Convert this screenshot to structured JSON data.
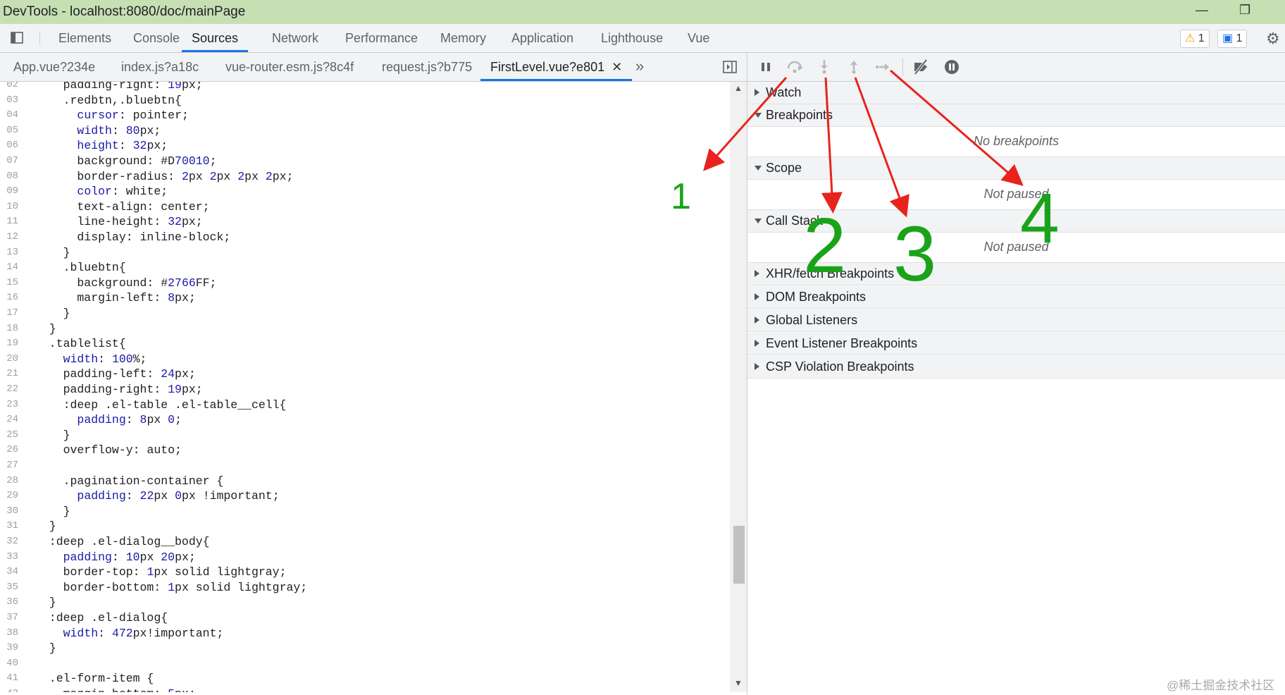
{
  "window": {
    "title": "DevTools - localhost:8080/doc/mainPage"
  },
  "panels": [
    {
      "label": "Elements"
    },
    {
      "label": "Console"
    },
    {
      "label": "Sources"
    },
    {
      "label": "Network"
    },
    {
      "label": "Performance"
    },
    {
      "label": "Memory"
    },
    {
      "label": "Application"
    },
    {
      "label": "Lighthouse"
    },
    {
      "label": "Vue"
    }
  ],
  "badges": {
    "warnings": "1",
    "messages": "1"
  },
  "file_tabs": [
    {
      "label": "App.vue?234e"
    },
    {
      "label": "index.js?a18c"
    },
    {
      "label": "vue-router.esm.js?8c4f"
    },
    {
      "label": "request.js?b775"
    },
    {
      "label": "FirstLevel.vue?e801"
    }
  ],
  "code_lines": [
    {
      "n": "02",
      "t": "    padding-right: 19px;"
    },
    {
      "n": "03",
      "t": "    .redbtn,.bluebtn{"
    },
    {
      "n": "04",
      "t": "      cursor: pointer;"
    },
    {
      "n": "05",
      "t": "      width: 80px;"
    },
    {
      "n": "06",
      "t": "      height: 32px;"
    },
    {
      "n": "07",
      "t": "      background: #D70010;"
    },
    {
      "n": "08",
      "t": "      border-radius: 2px 2px 2px 2px;"
    },
    {
      "n": "09",
      "t": "      color: white;"
    },
    {
      "n": "10",
      "t": "      text-align: center;"
    },
    {
      "n": "11",
      "t": "      line-height: 32px;"
    },
    {
      "n": "12",
      "t": "      display: inline-block;"
    },
    {
      "n": "13",
      "t": "    }"
    },
    {
      "n": "14",
      "t": "    .bluebtn{"
    },
    {
      "n": "15",
      "t": "      background: #2766FF;"
    },
    {
      "n": "16",
      "t": "      margin-left: 8px;"
    },
    {
      "n": "17",
      "t": "    }"
    },
    {
      "n": "18",
      "t": "  }"
    },
    {
      "n": "19",
      "t": "  .tablelist{"
    },
    {
      "n": "20",
      "t": "    width: 100%;"
    },
    {
      "n": "21",
      "t": "    padding-left: 24px;"
    },
    {
      "n": "22",
      "t": "    padding-right: 19px;"
    },
    {
      "n": "23",
      "t": "    :deep .el-table .el-table__cell{"
    },
    {
      "n": "24",
      "t": "      padding: 8px 0;"
    },
    {
      "n": "25",
      "t": "    }"
    },
    {
      "n": "26",
      "t": "    overflow-y: auto;"
    },
    {
      "n": "27",
      "t": ""
    },
    {
      "n": "28",
      "t": "    .pagination-container {"
    },
    {
      "n": "29",
      "t": "      padding: 22px 0px !important;"
    },
    {
      "n": "30",
      "t": "    }"
    },
    {
      "n": "31",
      "t": "  }"
    },
    {
      "n": "32",
      "t": "  :deep .el-dialog__body{"
    },
    {
      "n": "33",
      "t": "    padding: 10px 20px;"
    },
    {
      "n": "34",
      "t": "    border-top: 1px solid lightgray;"
    },
    {
      "n": "35",
      "t": "    border-bottom: 1px solid lightgray;"
    },
    {
      "n": "36",
      "t": "  }"
    },
    {
      "n": "37",
      "t": "  :deep .el-dialog{"
    },
    {
      "n": "38",
      "t": "    width: 472px!important;"
    },
    {
      "n": "39",
      "t": "  }"
    },
    {
      "n": "40",
      "t": ""
    },
    {
      "n": "41",
      "t": "  .el-form-item {"
    },
    {
      "n": "42",
      "t": "    margin-bottom: 5px;"
    }
  ],
  "debugger": {
    "sections": {
      "watch": "Watch",
      "breakpoints": "Breakpoints",
      "breakpoints_empty": "No breakpoints",
      "scope": "Scope",
      "scope_empty": "Not paused",
      "callstack": "Call Stack",
      "callstack_empty": "Not paused",
      "xhr": "XHR/fetch Breakpoints",
      "dom": "DOM Breakpoints",
      "global": "Global Listeners",
      "event": "Event Listener Breakpoints",
      "csp": "CSP Violation Breakpoints"
    }
  },
  "annotations": {
    "n1": "1",
    "n2": "2",
    "n3": "3",
    "n4": "4",
    "arrow_color": "#e8231d",
    "number_color": "#1aa31a"
  },
  "watermark": "@稀土掘金技术社区"
}
